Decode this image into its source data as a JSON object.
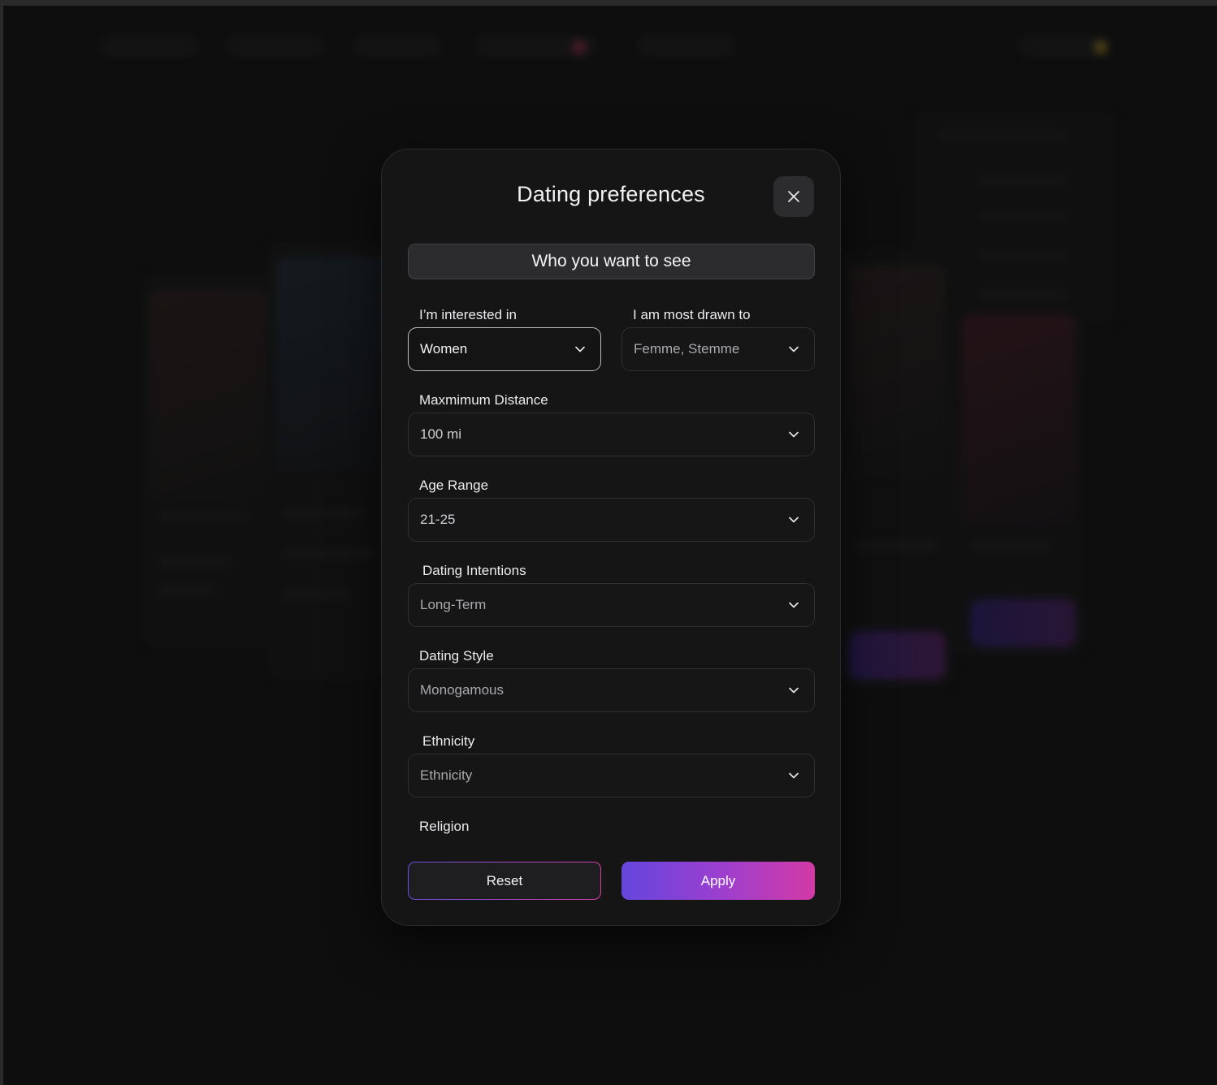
{
  "modal": {
    "title": "Dating preferences",
    "section_title": "Who you want to see",
    "close_icon": "close-icon"
  },
  "fields": {
    "interested_in": {
      "label": "I’m interested in",
      "value": "Women"
    },
    "drawn_to": {
      "label": "I am most drawn to",
      "value": "Femme, Stemme"
    },
    "max_distance": {
      "label": "Maxmimum Distance",
      "value": "100 mi"
    },
    "age_range": {
      "label": "Age Range",
      "value": "21-25"
    },
    "dating_intentions": {
      "label": "Dating Intentions",
      "value": "Long-Term"
    },
    "dating_style": {
      "label": "Dating Style",
      "value": "Monogamous"
    },
    "ethnicity": {
      "label": "Ethnicity",
      "placeholder": "Ethnicity"
    },
    "religion": {
      "label": "Religion"
    }
  },
  "actions": {
    "reset_label": "Reset",
    "apply_label": "Apply"
  },
  "colors": {
    "gradient_start": "#6546dd",
    "gradient_end": "#d33aa6",
    "modal_bg": "#151516",
    "page_bg": "#111112"
  }
}
